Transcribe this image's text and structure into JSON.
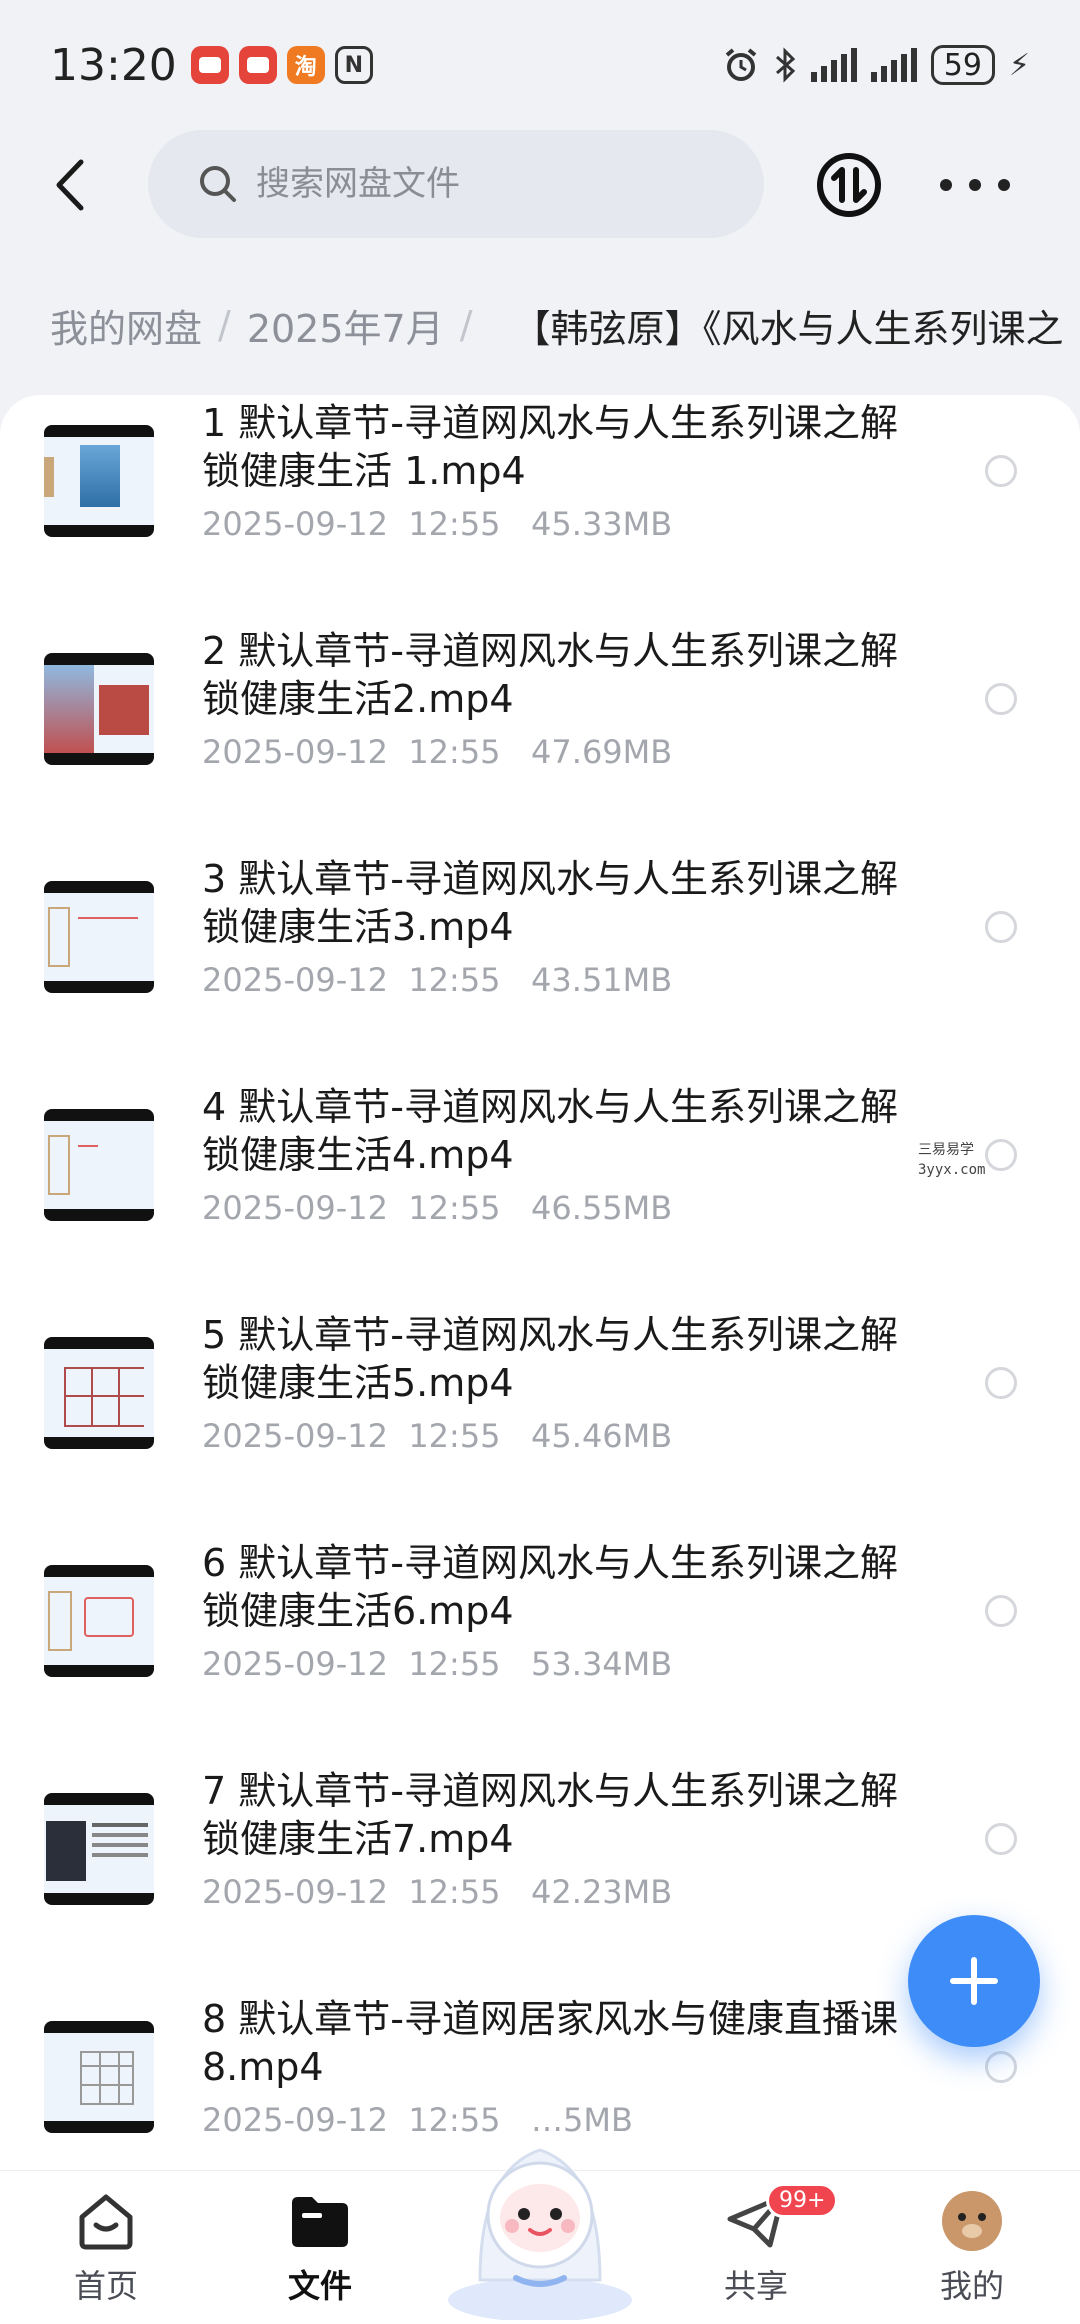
{
  "status_bar": {
    "time": "13:20",
    "notifications": [
      "red-app-icon",
      "red-app-icon",
      "taobao-icon",
      "nfc-icon"
    ],
    "taobao_label": "淘",
    "nfc_label": "N",
    "battery": "59"
  },
  "search": {
    "placeholder": "搜索网盘文件"
  },
  "breadcrumb": {
    "items": [
      "我的网盘",
      "2025年7月"
    ],
    "current": "【韩弦原】《风水与人生系列课之"
  },
  "files": [
    {
      "name": "1 默认章节-寻道网风水与人生系列课之解锁健康生活 1.mp4",
      "date": "2025-09-12  12:55",
      "size": "45.33MB"
    },
    {
      "name": "2 默认章节-寻道网风水与人生系列课之解锁健康生活2.mp4",
      "date": "2025-09-12  12:55",
      "size": "47.69MB"
    },
    {
      "name": "3 默认章节-寻道网风水与人生系列课之解锁健康生活3.mp4",
      "date": "2025-09-12  12:55",
      "size": "43.51MB"
    },
    {
      "name": "4 默认章节-寻道网风水与人生系列课之解锁健康生活4.mp4",
      "date": "2025-09-12  12:55",
      "size": "46.55MB"
    },
    {
      "name": "5 默认章节-寻道网风水与人生系列课之解锁健康生活5.mp4",
      "date": "2025-09-12  12:55",
      "size": "45.46MB"
    },
    {
      "name": "6 默认章节-寻道网风水与人生系列课之解锁健康生活6.mp4",
      "date": "2025-09-12  12:55",
      "size": "53.34MB"
    },
    {
      "name": "7 默认章节-寻道网风水与人生系列课之解锁健康生活7.mp4",
      "date": "2025-09-12  12:55",
      "size": "42.23MB"
    },
    {
      "name": "8 默认章节-寻道网居家风水与健康直播课8.mp4",
      "date": "2025-09-12  12:55",
      "size": "…5MB"
    }
  ],
  "watermark": {
    "line1": "三易易学",
    "line2": "3yyx.com"
  },
  "bottom_nav": {
    "items": [
      {
        "label": "首页",
        "icon": "home-icon"
      },
      {
        "label": "文件",
        "icon": "folder-icon",
        "active": true
      },
      {
        "label": "共享",
        "icon": "share-paper-plane-icon",
        "badge": "99+"
      },
      {
        "label": "我的",
        "icon": "avatar-icon"
      }
    ]
  },
  "colors": {
    "accent": "#3d8cf7",
    "badge": "#f0454f"
  }
}
